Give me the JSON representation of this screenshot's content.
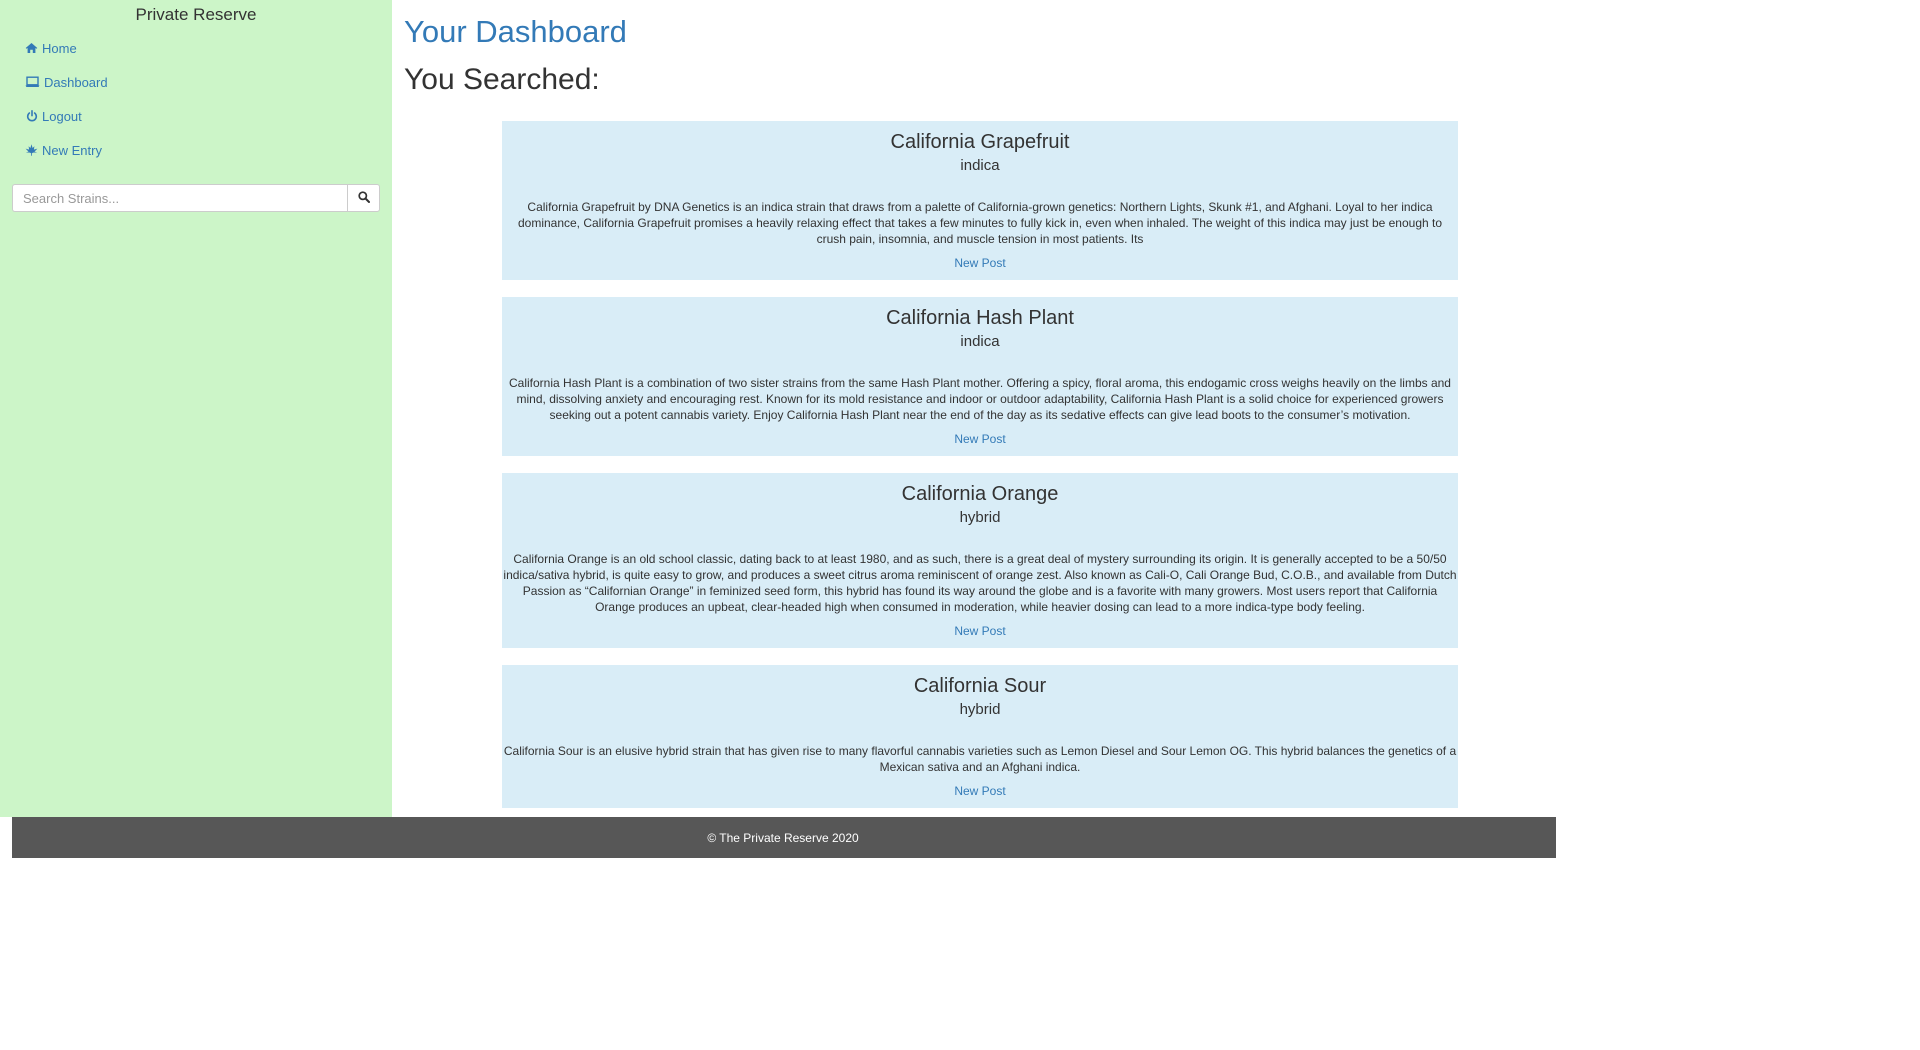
{
  "sidebar": {
    "brand": "Private Reserve",
    "nav": [
      {
        "label": "Home",
        "icon": "home-icon"
      },
      {
        "label": "Dashboard",
        "icon": "laptop-icon"
      },
      {
        "label": "Logout",
        "icon": "power-icon"
      },
      {
        "label": "New Entry",
        "icon": "leaf-icon"
      }
    ],
    "search": {
      "placeholder": "Search Strains...",
      "value": "",
      "button_icon": "search-icon"
    }
  },
  "main": {
    "title": "Your Dashboard",
    "subtitle": "You Searched:",
    "results": [
      {
        "name": "California Grapefruit",
        "type": "indica",
        "description": "California Grapefruit by DNA Genetics is an indica strain that draws from a palette of California-grown genetics: Northern Lights, Skunk #1, and Afghani. Loyal to her indica dominance, California Grapefruit promises a heavily relaxing effect that takes a few minutes to fully kick in, even when inhaled. The weight of this indica may just be enough to crush pain, insomnia, and muscle tension in most patients. Its",
        "link": "New Post"
      },
      {
        "name": "California Hash Plant",
        "type": "indica",
        "description": "California Hash Plant is a combination of two sister strains from the same Hash Plant mother. Offering a spicy, floral aroma, this endogamic cross weighs heavily on the limbs and mind, dissolving anxiety and encouraging rest. Known for its mold resistance and indoor or outdoor adaptability, California Hash Plant is a solid choice for experienced growers seeking out a potent cannabis variety. Enjoy California Hash Plant near the end of the day as its sedative effects can give lead boots to the consumer’s motivation.",
        "link": "New Post"
      },
      {
        "name": "California Orange",
        "type": "hybrid",
        "description": "California Orange is an old school classic, dating back to at least 1980, and as such, there is a great deal of mystery surrounding its origin. It is generally accepted to be a 50/50 indica/sativa hybrid, is quite easy to grow, and produces a sweet citrus aroma reminiscent of orange zest. Also known as Cali-O, Cali Orange Bud, C.O.B., and available from Dutch Passion as “Californian Orange” in feminized seed form, this hybrid has found its way around the globe and is a favorite with many growers. Most users report that California Orange produces an upbeat, clear-headed high when consumed in moderation, while heavier dosing can lead to a more indica-type body feeling.",
        "link": "New Post"
      },
      {
        "name": "California Sour",
        "type": "hybrid",
        "description": "California Sour is an elusive hybrid strain that has given rise to many flavorful cannabis varieties such as Lemon Diesel and Sour Lemon OG. This hybrid balances the genetics of a Mexican sativa and an Afghani indica.",
        "link": "New Post"
      }
    ]
  },
  "footer": {
    "text": "© The Private Reserve 2020"
  },
  "colors": {
    "sidebar_bg": "#ccf5c8",
    "card_bg": "#d9edf7",
    "link": "#337ab7",
    "footer_bg": "#575757"
  }
}
